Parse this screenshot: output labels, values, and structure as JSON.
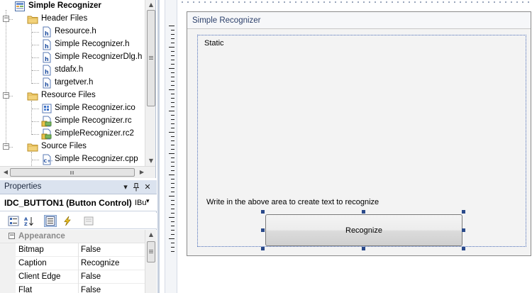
{
  "solution_explorer": {
    "project": "Simple Recognizer",
    "header_files": {
      "label": "Header Files",
      "files": [
        "Resource.h",
        "Simple Recognizer.h",
        "Simple RecognizerDlg.h",
        "stdafx.h",
        "targetver.h"
      ]
    },
    "resource_files": {
      "label": "Resource Files",
      "files": [
        "Simple Recognizer.ico",
        "Simple Recognizer.rc",
        "SimpleRecognizer.rc2"
      ]
    },
    "source_files": {
      "label": "Source Files",
      "files": [
        "Simple Recognizer.cpp"
      ]
    }
  },
  "properties": {
    "title": "Properties",
    "object": "IDC_BUTTON1 (Button Control)",
    "object_type": "IBu",
    "category": "Appearance",
    "rows": [
      {
        "name": "Bitmap",
        "value": "False"
      },
      {
        "name": "Caption",
        "value": "Recognize"
      },
      {
        "name": "Client Edge",
        "value": "False"
      },
      {
        "name": "Flat",
        "value": "False"
      }
    ]
  },
  "dialog": {
    "title": "Simple Recognizer",
    "static_label": "Static",
    "hint": "Write in the above area to create text to recognize",
    "button_label": "Recognize"
  },
  "colors": {
    "panel_title_bg": "#dbe3ef",
    "selection_handle": "#2a4a8a",
    "dialog_bg": "#f3f3f3"
  }
}
